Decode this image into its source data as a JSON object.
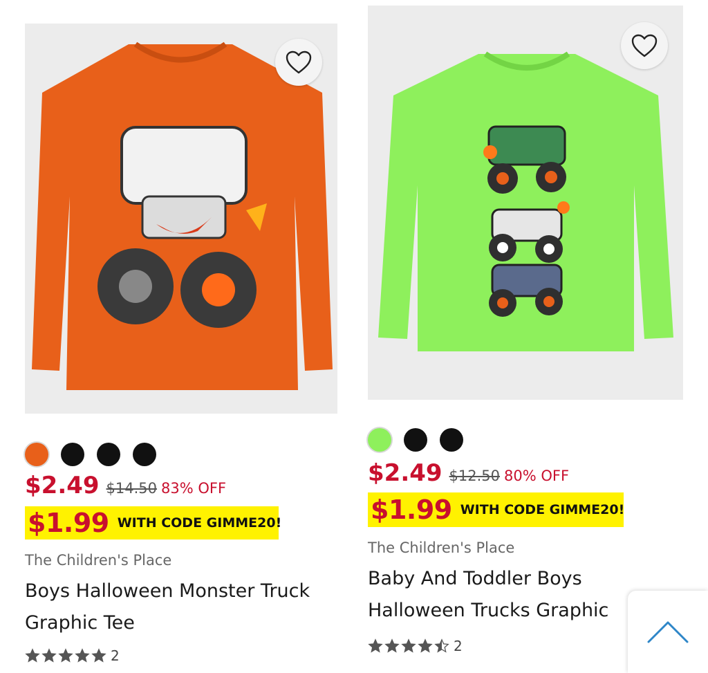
{
  "products": [
    {
      "image_color": "#e8601a",
      "swatches": [
        "#e8601a",
        "#111111",
        "#111111",
        "#111111"
      ],
      "price": "$2.49",
      "original_price": "$14.50",
      "discount": "83% OFF",
      "promo_price": "$1.99",
      "promo_text": "WITH CODE GIMME20!",
      "brand": "The Children's Place",
      "title": "Boys Halloween Monster Truck Graphic Tee",
      "rating": 5,
      "review_count": "2"
    },
    {
      "image_color": "#8ef05c",
      "swatches": [
        "#8ef05c",
        "#111111",
        "#111111"
      ],
      "price": "$2.49",
      "original_price": "$12.50",
      "discount": "80% OFF",
      "promo_price": "$1.99",
      "promo_text": "WITH CODE GIMME20!",
      "brand": "The Children's Place",
      "title": "Baby And Toddler Boys Halloween Trucks Graphic",
      "rating": 4.5,
      "review_count": "2"
    }
  ],
  "colors": {
    "sale_red": "#c8102e",
    "promo_yellow": "#fff200",
    "star_gray": "#555555"
  },
  "icons": {
    "favorite": "heart-outline-icon",
    "back_to_top": "chevron-up-icon",
    "rating": "star-icon"
  }
}
